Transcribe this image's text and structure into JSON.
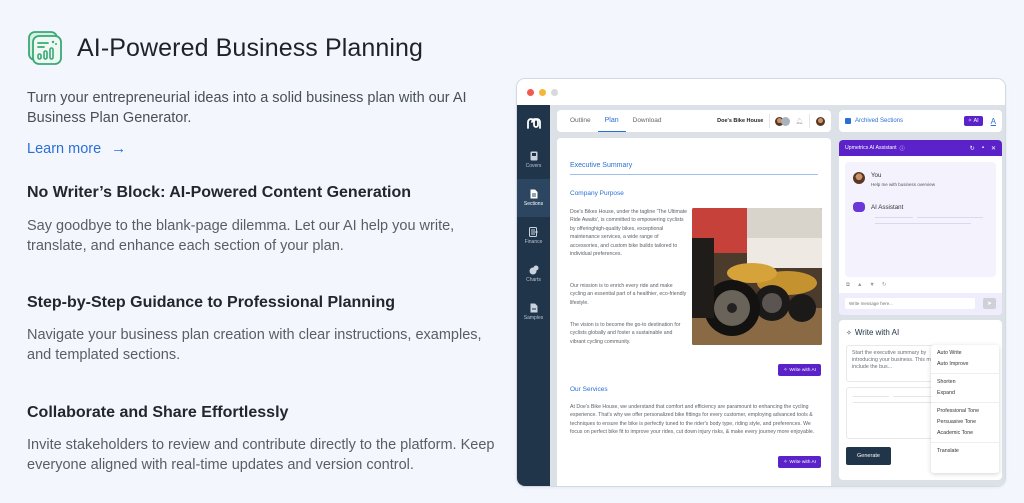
{
  "hero": {
    "title": "AI-Powered Business Planning",
    "icon": "chart-dashboard-icon",
    "accent": "#3aa876",
    "intro": "Turn your entrepreneurial ideas into a solid business plan with our AI Business Plan Generator.",
    "learn_more": "Learn more",
    "learn_more_arrow": "→",
    "link_color": "#2b6fd6"
  },
  "features": [
    {
      "title": "No Writer’s Block: AI-Powered Content Generation",
      "text": "Say goodbye to the blank-page dilemma. Let our AI help you write, translate, and enhance each section of your plan."
    },
    {
      "title": "Step-by-Step Guidance to Professional Planning",
      "text": "Navigate your business plan creation with clear instructions, examples, and templated sections."
    },
    {
      "title": "Collaborate and Share Effortlessly",
      "text": "Invite stakeholders to review and contribute directly to the platform. Keep everyone aligned with real-time updates and version control."
    }
  ],
  "app": {
    "brand_color": "#5b22c9",
    "sidebar_color": "#20344a",
    "sidebar": [
      {
        "label": "Covers",
        "icon": "cover-page-icon"
      },
      {
        "label": "Sections",
        "icon": "document-icon",
        "active": true
      },
      {
        "label": "Finance",
        "icon": "finance-icon"
      },
      {
        "label": "Charts",
        "icon": "charts-icon"
      },
      {
        "label": "Samples",
        "icon": "samples-icon"
      }
    ],
    "tabs": [
      {
        "label": "Outline"
      },
      {
        "label": "Plan",
        "active": true
      },
      {
        "label": "Download"
      }
    ],
    "business_name": "Doe's Bike House",
    "document": {
      "section_title": "Executive Summary",
      "company_purpose_title": "Company Purpose",
      "company_purpose_paragraphs": [
        "Doe's Bikes House, under the tagline 'The Ultimate Ride Awaits', is committed to empowering cyclists by offeringhigh-quality bikes, exceptional maintenance services, a wide range of accessories, and custom bike builds tailored to individual preferences.",
        "Our mission is to enrich every ride and make cycling an essential part of a healthier, eco-friendly lifestyle.",
        "The vision is to become the go-to destination for cyclists globally and foster a sustainable and vibrant cycling community."
      ],
      "write_with_ai_label": "Write with AI",
      "services_title": "Our Services",
      "services_text": "At Doe's Bike House, we understand that comfort and efficiency are paramount to enhancing the cycling experience. That's why we offer personalized bike fittings for every customer, employing advanced tools & techniques to ensure the bike is perfectly tuned to the rider's body type, riding style, and preferences. We focus on perfect bike fit to improve your rides, cut down injury risks, & make every journey more enjoyable."
    },
    "right_top": {
      "archived_label": "Archived Sections",
      "ai_chip": "AI",
      "font_icon_label": "A"
    },
    "assistant": {
      "title": "Upmetrics AI Assistant",
      "user_name": "You",
      "user_message": "Help me with business overview",
      "bot_name": "AI Assistant",
      "input_placeholder": "Write message here..."
    },
    "write_ai": {
      "title": "Write with AI",
      "prompt_text": "Start the executive summary by introducing your business. This may include the bus...",
      "generate_label": "Generate",
      "menu_groups": [
        [
          "Auto Write",
          "Auto Improve"
        ],
        [
          "Shorten",
          "Expand"
        ],
        [
          "Professional Tone",
          "Persuasive Tone",
          "Academic Tone"
        ],
        [
          "Translate"
        ]
      ]
    }
  }
}
